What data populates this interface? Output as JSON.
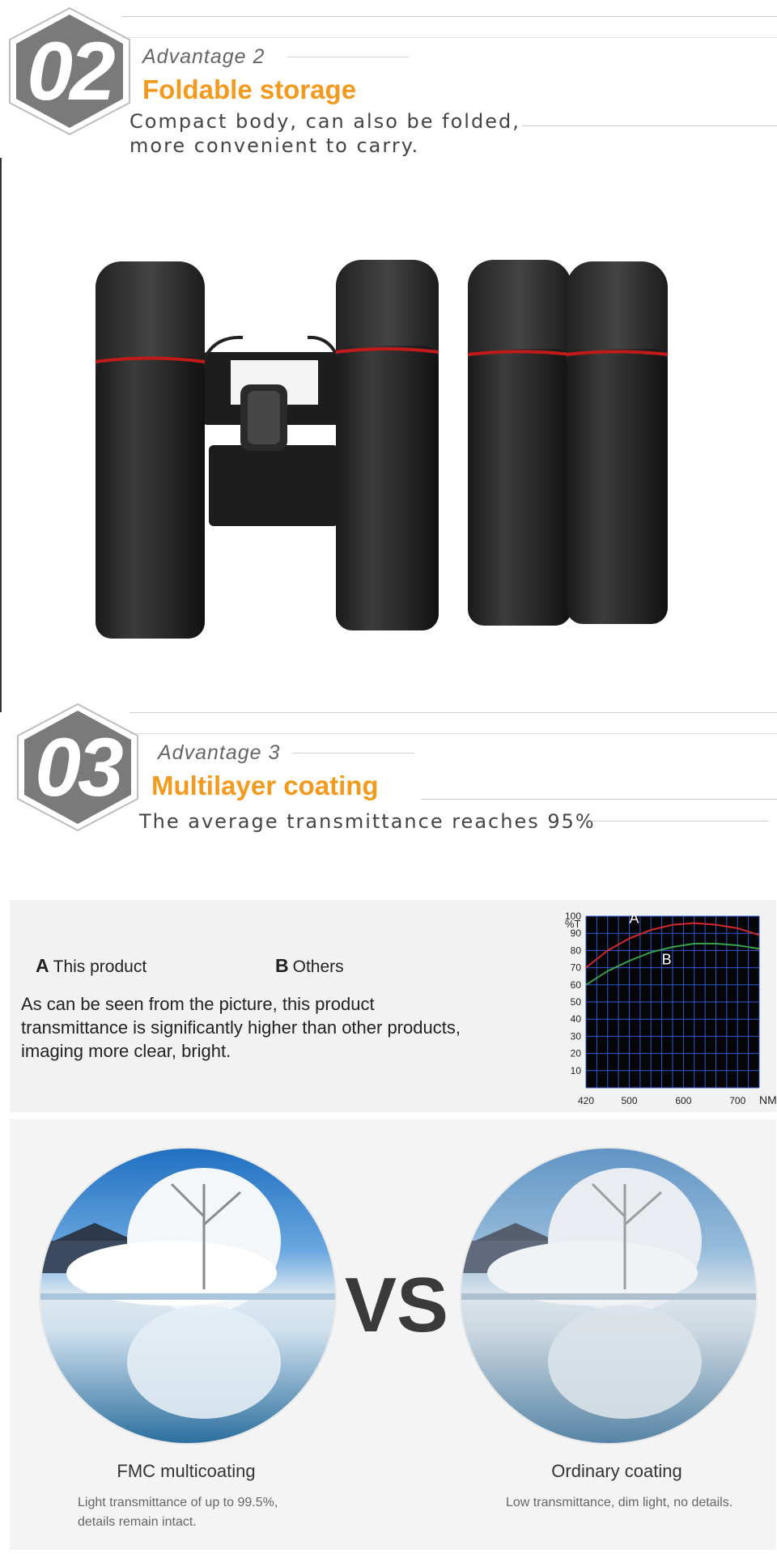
{
  "advantage2": {
    "number": "02",
    "label": "Advantage  2",
    "title": "Foldable storage",
    "desc_line1": "Compact body, can also be folded,",
    "desc_line2": "more convenient to carry."
  },
  "advantage3": {
    "number": "03",
    "label": "Advantage  3",
    "title": "Multilayer coating",
    "desc": "The average transmittance reaches 95%"
  },
  "transmittance": {
    "legend_a_letter": "A",
    "legend_a_label": "This product",
    "legend_b_letter": "B",
    "legend_b_label": "Others",
    "desc_line1": "As can be seen from the picture, this product",
    "desc_line2": "transmittance is significantly higher than other products,",
    "desc_line3": "imaging more clear, bright."
  },
  "chart_data": {
    "type": "line",
    "ylabel": "%T",
    "xlabel": "NM",
    "xlim": [
      420,
      740
    ],
    "ylim": [
      0,
      100
    ],
    "x_ticks": [
      420,
      500,
      600,
      700
    ],
    "y_ticks": [
      10,
      20,
      30,
      40,
      50,
      60,
      70,
      80,
      90,
      100
    ],
    "grid": true,
    "series": [
      {
        "name": "A",
        "color": "#d42a2a",
        "x": [
          420,
          460,
          500,
          540,
          580,
          620,
          660,
          700,
          740
        ],
        "values": [
          70,
          80,
          87,
          92,
          95,
          96,
          95,
          93,
          89
        ]
      },
      {
        "name": "B",
        "color": "#3aa14a",
        "x": [
          420,
          460,
          500,
          540,
          580,
          620,
          660,
          700,
          740
        ],
        "values": [
          60,
          68,
          74,
          79,
          82,
          84,
          84,
          83,
          81
        ]
      }
    ]
  },
  "comparison": {
    "vs_text": "VS",
    "left_caption": "FMC multicoating",
    "left_sub_line1": "Light transmittance of up to 99.5%,",
    "left_sub_line2": "details remain intact.",
    "right_caption": "Ordinary coating",
    "right_sub": "Low transmittance, dim light, no details."
  },
  "colors": {
    "accent": "#f39a1e",
    "badge": "#7a7a7a",
    "chart_bg": "#050505",
    "chart_grid": "#2d5bd6"
  }
}
